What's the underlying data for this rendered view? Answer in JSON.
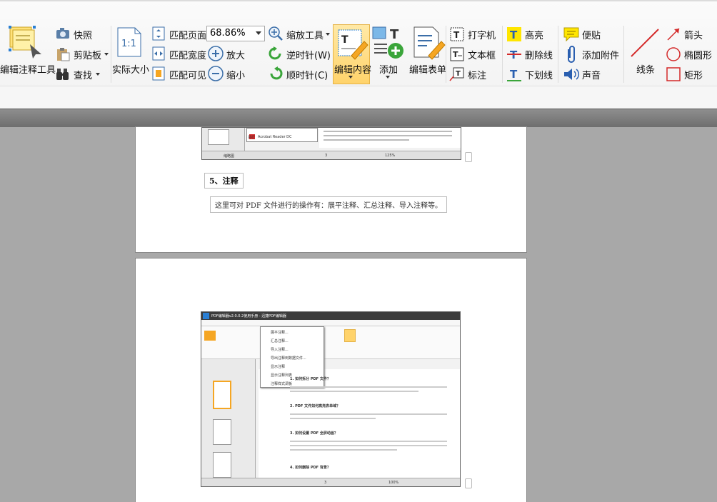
{
  "toolbar": {
    "edit_annot_tool": "编辑注释工具",
    "snapshot": "快照",
    "clipboard": "剪贴板",
    "find": "查找",
    "actual_size": "实际大小",
    "fit_page": "匹配页面",
    "fit_width": "匹配宽度",
    "fit_visible": "匹配可见",
    "zoom_value": "68.86%",
    "zoom_in": "放大",
    "zoom_out": "缩小",
    "zoom_tool": "缩放工具",
    "rotate_ccw": "逆时针(W)",
    "rotate_cw": "顺时针(C)",
    "edit_content": "编辑内容",
    "add": "添加",
    "edit_form": "编辑表单",
    "typewriter": "打字机",
    "textbox": "文本框",
    "callout": "标注",
    "highlight": "高亮",
    "strikeout": "删除线",
    "underline": "下划线",
    "sticky_note": "便贴",
    "attach_file": "添加附件",
    "sound": "声音",
    "line": "线条",
    "arrow": "箭头",
    "ellipse": "椭圆形",
    "rectangle": "矩形"
  },
  "colors": {
    "accent_blue": "#2a7fd4",
    "highlight_yellow": "#ffd36b",
    "green": "#3aa53a",
    "red": "#d42a2a"
  },
  "document": {
    "page1": {
      "section_title": "5、注释",
      "section_text": "这里可对 PDF 文件进行的操作有：展平注释、汇总注释、导入注释等。",
      "menu_item": "Acrobat Reader DC",
      "menu_prefix": "另行",
      "page_indicator": "3",
      "zoom": "125%",
      "thumb_label": "缩略图"
    },
    "page2": {
      "title_bar": "PDF编辑器v2.0.0.2使用手册 - 迅捷PDF编辑器",
      "q1": "1. 如何拆分 PDF 文件？",
      "q2": "2. PDF 文件如何高亮表单域？",
      "q3": "3. 如何设置 PDF 全屏动画？",
      "q4": "4. 如何删除 PDF 背景？",
      "menu_items": [
        "展平注释...",
        "汇总注释...",
        "导入注释...",
        "导出注释到数据文件...",
        "显示注释",
        "显示注释列表",
        "注释样式调板"
      ],
      "zoom": "100%",
      "page_indicator": "3"
    }
  }
}
